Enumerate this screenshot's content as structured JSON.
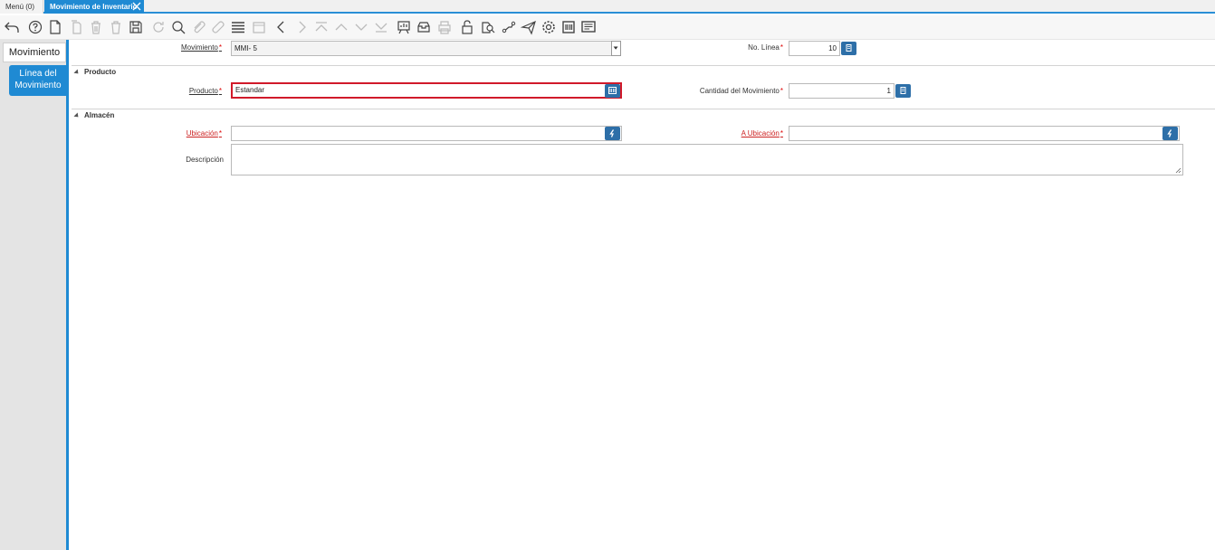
{
  "tabs": {
    "menu_label": "Menú (0)",
    "active_label": "Movimiento de Inventario"
  },
  "toolbar": {
    "icons": [
      "undo-icon",
      "help-icon",
      "new-icon",
      "copy-icon",
      "delete-icon",
      "delete-selection-icon",
      "save-icon",
      "refresh-icon",
      "find-icon",
      "attachment-icon",
      "chat-icon",
      "grid-toggle-icon",
      "history-icon",
      "previous-icon",
      "next-icon",
      "first-icon",
      "parent-icon",
      "detail-icon",
      "last-icon",
      "report-icon",
      "archive-icon",
      "print-icon",
      "lock-icon",
      "zoom-across-icon",
      "workflow-icon",
      "request-icon",
      "process-icon",
      "product-info-icon",
      "post-it-icon"
    ]
  },
  "sidebar": {
    "items": [
      {
        "label": "Movimiento"
      },
      {
        "label": "Línea del Movimiento"
      }
    ]
  },
  "form": {
    "movimiento": {
      "label": "Movimiento",
      "value": "MMI- 5"
    },
    "no_linea": {
      "label": "No. Línea",
      "value": "10"
    },
    "section_producto": "Producto",
    "producto": {
      "label": "Producto",
      "value": "Estandar"
    },
    "cantidad": {
      "label": "Cantidad del Movimiento",
      "value": "1"
    },
    "section_almacen": "Almacén",
    "ubicacion": {
      "label": "Ubicación",
      "value": ""
    },
    "a_ubicacion": {
      "label": "A Ubicación",
      "value": ""
    },
    "descripcion": {
      "label": "Descripción",
      "value": ""
    }
  },
  "colors": {
    "accent": "#1f8ad3",
    "button": "#2d6fa8",
    "required": "#dd0000",
    "highlight_border": "#d11a2a"
  }
}
